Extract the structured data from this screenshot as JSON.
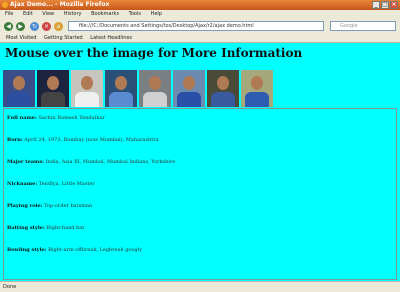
{
  "window": {
    "title": "Ajax Demo... - Mozilla Firefox"
  },
  "menu": [
    "File",
    "Edit",
    "View",
    "History",
    "Bookmarks",
    "Tools",
    "Help"
  ],
  "nav": {
    "url": "file:///C:/Documents and Settings/tos/Desktop/Ajax/r2/ajax demo.html",
    "search_placeholder": "Google"
  },
  "bookmarks": [
    "Most Visited",
    "Getting Started",
    "Latest Headlines"
  ],
  "page": {
    "heading": "Mouse over the image for More Information",
    "photos": [
      {
        "bg": "#3a4f8a",
        "jersey": "#2c4fa0"
      },
      {
        "bg": "#1c2440",
        "jersey": "#444"
      },
      {
        "bg": "#c8c5bf",
        "jersey": "#f0f0f0"
      },
      {
        "bg": "#2a5078",
        "jersey": "#5a8ad0"
      },
      {
        "bg": "#7a7f84",
        "jersey": "#d0d0d0"
      },
      {
        "bg": "#6c8bb0",
        "jersey": "#2a4fa8"
      },
      {
        "bg": "#4a4a38",
        "jersey": "#3a5aa0"
      },
      {
        "bg": "#a4a87a",
        "jersey": "#2c5bb0"
      }
    ],
    "info": [
      {
        "label": "Full name:",
        "value": "Sachin Ramesh Tendulkar"
      },
      {
        "label": "Born:",
        "value": "April 24, 1973, Bombay (now Mumbai), Maharashtra"
      },
      {
        "label": "Major teams:",
        "value": "India, Asia XI, Mumbai, Mumbai Indians, Yorkshire"
      },
      {
        "label": "Nickname:",
        "value": "Tendlya, Little Master"
      },
      {
        "label": "Playing role:",
        "value": "Top-order batsman"
      },
      {
        "label": "Batting style:",
        "value": "Right-hand bat"
      },
      {
        "label": "Bowling style:",
        "value": "Right-arm offbreak, Legbreak googly"
      }
    ]
  },
  "status": "Done"
}
